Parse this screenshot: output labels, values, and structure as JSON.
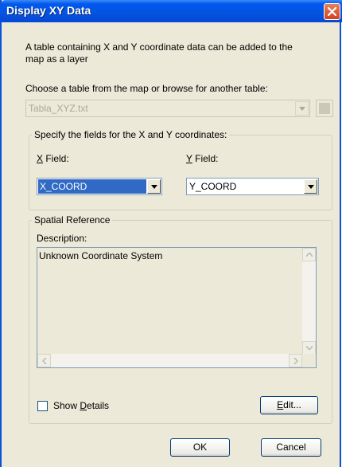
{
  "window": {
    "title": "Display XY Data"
  },
  "intro": {
    "line1": "A table containing X and Y coordinate data can be added to the",
    "line2": "map as a layer"
  },
  "table": {
    "label": "Choose a table from the map or browse for another table:",
    "value": "Tabla_XYZ.txt"
  },
  "fields_group": {
    "title": "Specify the fields for the X and Y coordinates:",
    "x_label_key": "X",
    "x_label_rest": " Field:",
    "x_value": "X_COORD",
    "y_label_key": "Y",
    "y_label_rest": " Field:",
    "y_value": "Y_COORD"
  },
  "spatial_group": {
    "title": "Spatial Reference",
    "description_label": "Description:",
    "description_text": "Unknown Coordinate System"
  },
  "show_details": {
    "before": "Show ",
    "key": "D",
    "after": "etails",
    "checked": false
  },
  "buttons": {
    "edit_key": "E",
    "edit_rest": "dit...",
    "ok": "OK",
    "cancel": "Cancel"
  },
  "colors": {
    "titlebar": "#0058EE",
    "dialog_bg": "#ECE9D8",
    "selection": "#316AC5",
    "close": "#D2421E"
  }
}
